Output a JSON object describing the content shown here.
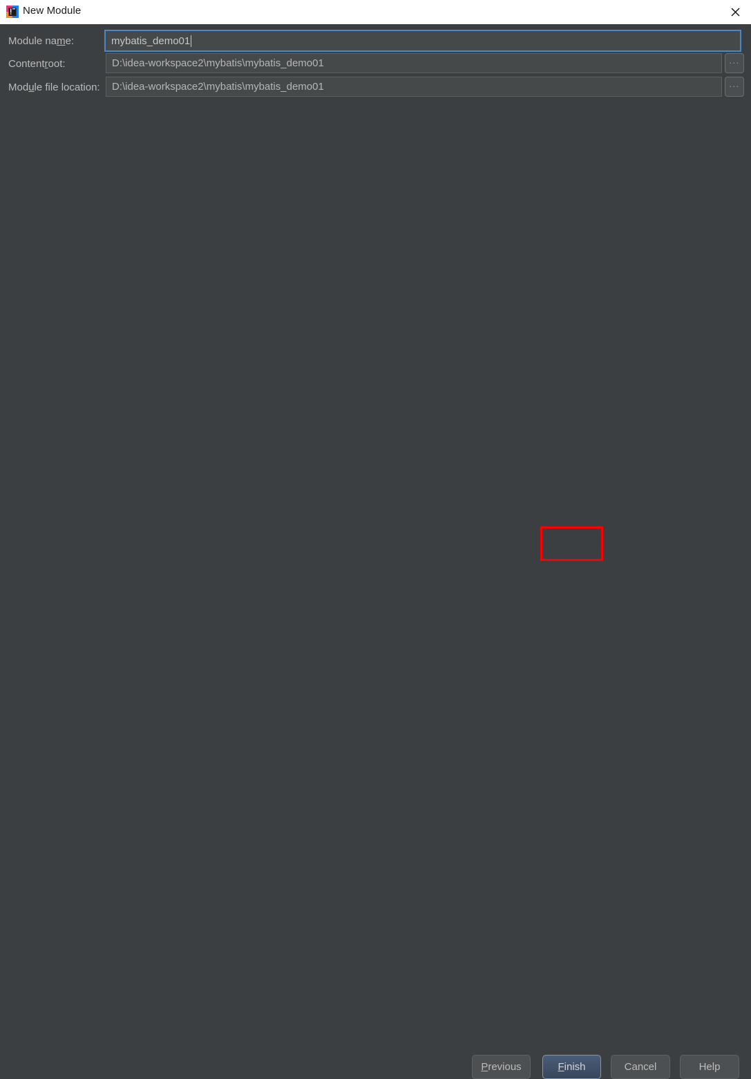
{
  "window": {
    "title": "New Module",
    "icon": "intellij-idea-icon",
    "close_label": "close-icon",
    "titlebar_bg": "#ffffff",
    "dialog_bg": "#3c3f41"
  },
  "form": {
    "fields": [
      {
        "label_before": "Module na",
        "label_mnemonic": "m",
        "label_after": "e:",
        "value": "mybatis_demo01",
        "placeholder": "",
        "focused": true,
        "has_browse": false,
        "browse_label": ""
      },
      {
        "label_before": "Content ",
        "label_mnemonic": "r",
        "label_after": "oot:",
        "value": "D:\\idea-workspace2\\mybatis\\mybatis_demo01",
        "placeholder": "",
        "focused": false,
        "has_browse": true,
        "browse_label": "..."
      },
      {
        "label_before": "Mod",
        "label_mnemonic": "u",
        "label_after": "le file location:",
        "value": "D:\\idea-workspace2\\mybatis\\mybatis_demo01",
        "placeholder": "",
        "focused": false,
        "has_browse": true,
        "browse_label": "..."
      }
    ]
  },
  "buttons": {
    "previous": {
      "before": "",
      "mnemonic": "P",
      "after": "revious"
    },
    "finish": {
      "before": "",
      "mnemonic": "F",
      "after": "inish"
    },
    "cancel": {
      "before": "Cancel",
      "mnemonic": "",
      "after": ""
    },
    "help": {
      "before": "Help",
      "mnemonic": "",
      "after": ""
    }
  },
  "annotation": {
    "color": "#ff0000",
    "target": "finish-button"
  }
}
